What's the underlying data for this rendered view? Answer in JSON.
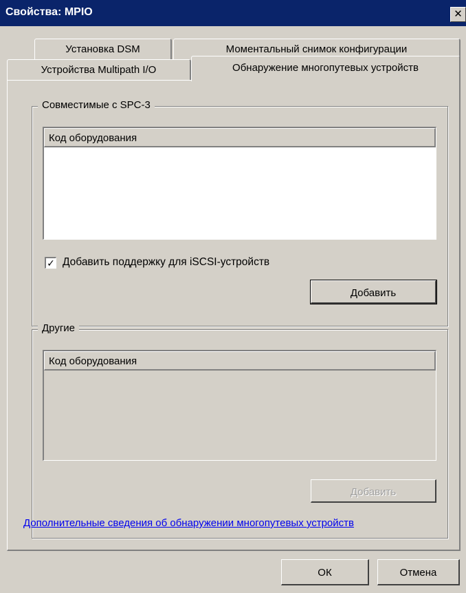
{
  "window": {
    "title": "Свойства: MPIO",
    "close_glyph": "✕"
  },
  "tabs": {
    "back_row": [
      "Установка DSM",
      "Моментальный снимок конфигурации"
    ],
    "front_row": [
      "Устройства Multipath I/O",
      "Обнаружение многопутевых устройств"
    ],
    "active": "Обнаружение многопутевых устройств"
  },
  "spc3_group": {
    "title": "Совместимые с SPC-3",
    "column_header": "Код оборудования",
    "rows": [],
    "checkbox_label": "Добавить поддержку для iSCSI-устройств",
    "checkbox_checked": true,
    "check_glyph": "✓",
    "add_button": "Добавить"
  },
  "other_group": {
    "title": "Другие",
    "column_header": "Код оборудования",
    "rows": [],
    "add_button": "Добавить",
    "add_button_disabled": true
  },
  "help_link": "Дополнительные сведения об обнаружении многопутевых устройств",
  "footer": {
    "ok": "ОК",
    "cancel": "Отмена"
  }
}
